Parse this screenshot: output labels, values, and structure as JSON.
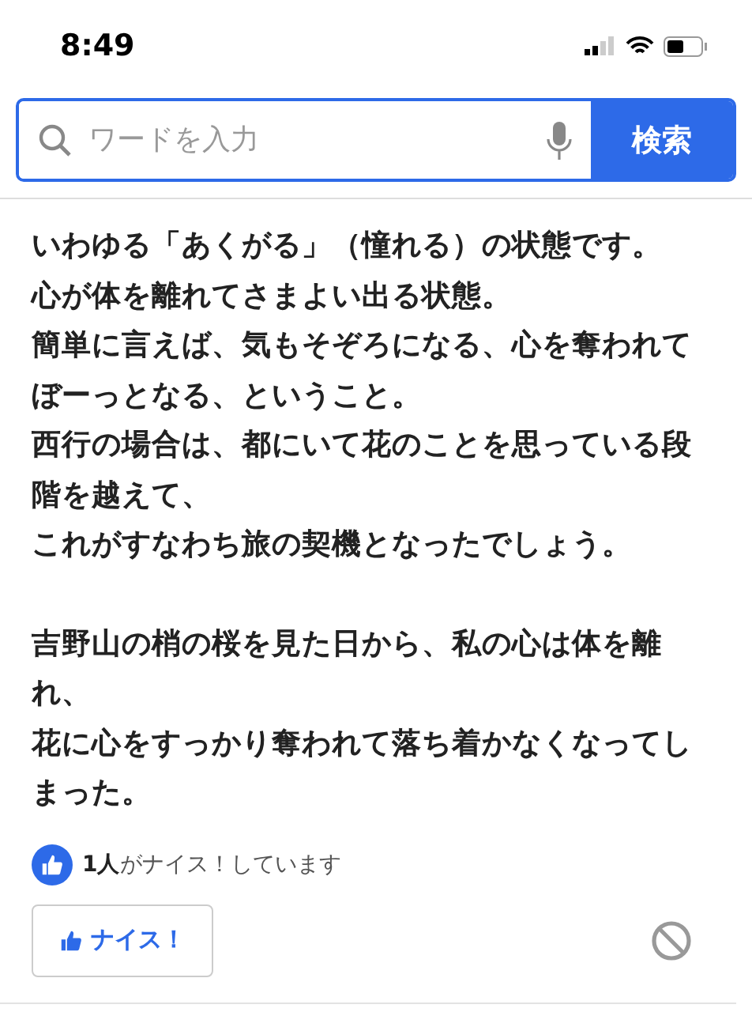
{
  "status_bar": {
    "time": "8:49"
  },
  "search": {
    "placeholder": "ワードを入力",
    "button": "検索"
  },
  "article": {
    "paragraphs": [
      [
        "いわゆる「あくがる」（憧れる）の状態です。",
        "心が体を離れてさまよい出る状態。",
        "簡単に言えば、気もそぞろになる、心を奪われてぼーっとなる、ということ。",
        "西行の場合は、都にいて花のことを思っている段階を越えて、",
        "これがすなわち旅の契機となったでしょう。"
      ],
      [
        "吉野山の梢の桜を見た日から、私の心は体を離れ、",
        "花に心をすっかり奪われて落ち着かなくなってしまった。"
      ]
    ]
  },
  "likes": {
    "summary": "**1人**がナイス！しています",
    "button": "ナイス！"
  }
}
